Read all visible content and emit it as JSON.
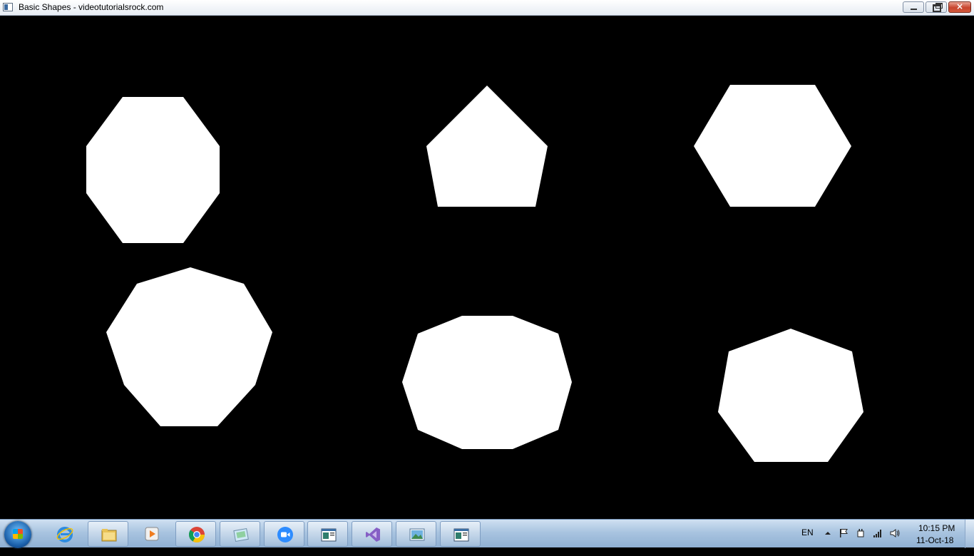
{
  "window": {
    "title": "Basic Shapes - videotutorialsrock.com",
    "buttons": {
      "minimize": "minimize",
      "maximize": "restore",
      "close": "×"
    }
  },
  "canvas": {
    "background": "#000000",
    "shape_color": "#ffffff",
    "shapes": [
      {
        "name": "octagon",
        "sides": 8
      },
      {
        "name": "pentagon",
        "sides": 5
      },
      {
        "name": "hexagon",
        "sides": 6
      },
      {
        "name": "nonagon",
        "sides": 9
      },
      {
        "name": "decagon",
        "sides": 10
      },
      {
        "name": "heptagon",
        "sides": 7
      }
    ]
  },
  "taskbar": {
    "pinned": [
      {
        "name": "internet-explorer-icon",
        "running": false
      },
      {
        "name": "file-explorer-icon",
        "running": true
      },
      {
        "name": "media-player-icon",
        "running": false
      },
      {
        "name": "chrome-icon",
        "running": true
      },
      {
        "name": "paint-icon",
        "running": true
      },
      {
        "name": "zoom-icon",
        "running": true
      },
      {
        "name": "app-window-icon",
        "running": true
      },
      {
        "name": "visual-studio-icon",
        "running": true
      },
      {
        "name": "photo-viewer-icon",
        "running": true
      },
      {
        "name": "app-window-icon",
        "running": true
      }
    ],
    "tray": {
      "language": "EN",
      "time": "10:15 PM",
      "date": "11-Oct-18"
    }
  }
}
